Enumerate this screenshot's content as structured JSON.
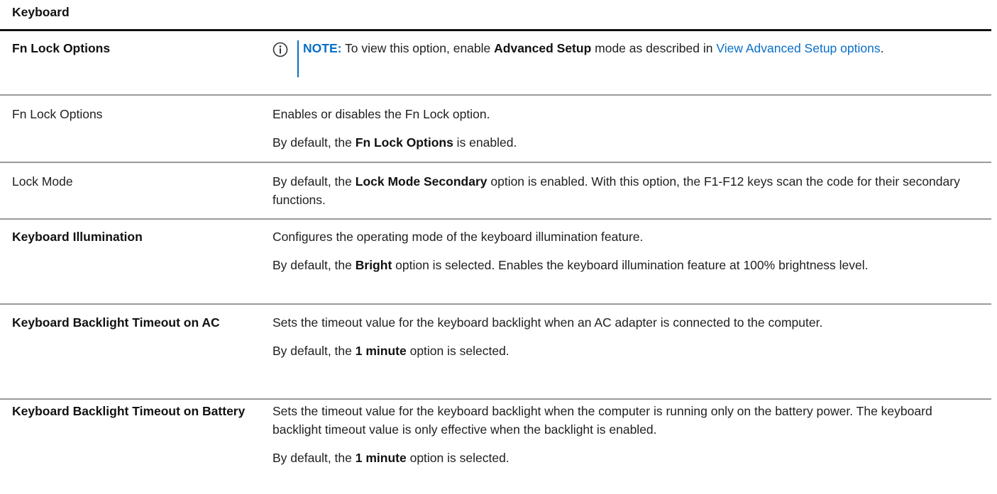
{
  "caption": "Keyboard",
  "rows": [
    {
      "name": "Fn Lock Options",
      "note_label": "NOTE:",
      "note_t1": " To view this option, enable ",
      "note_b1": "Advanced Setup",
      "note_t2": " mode as described in ",
      "note_link": "View Advanced Setup options",
      "note_t3": "."
    },
    {
      "name": "Fn Lock Options",
      "desc1": "Enables or disables the Fn Lock option.",
      "d2_t1": "By default, the ",
      "d2_b1": "Fn Lock Options",
      "d2_t2": " is enabled."
    },
    {
      "name": "Lock Mode",
      "d1_t1": "By default, the ",
      "d1_b1": "Lock Mode Secondary",
      "d1_t2": " option is enabled. With this option, the F1-F12 keys scan the code for their secondary functions."
    },
    {
      "name": "Keyboard Illumination",
      "desc1": "Configures the operating mode of the keyboard illumination feature.",
      "d2_t1": "By default, the ",
      "d2_b1": "Bright",
      "d2_t2": " option is selected. Enables the keyboard illumination feature at 100% brightness level."
    },
    {
      "name": "Keyboard Backlight Timeout on AC",
      "desc1": "Sets the timeout value for the keyboard backlight when an AC adapter is connected to the computer.",
      "d2_t1": "By default, the ",
      "d2_b1": "1 minute",
      "d2_t2": " option is selected."
    },
    {
      "name": "Keyboard Backlight Timeout on Battery",
      "desc1": "Sets the timeout value for the keyboard backlight when the computer is running only on the battery power. The keyboard backlight timeout value is only effective when the backlight is enabled.",
      "d2_t1": "By default, the ",
      "d2_b1": "1 minute",
      "d2_t2": " option is selected."
    }
  ],
  "colors": {
    "accent": "#0a6fc7",
    "divider": "#9a9a9a",
    "header_rule": "#111111"
  },
  "icons": {
    "note": "info-circle-icon"
  }
}
